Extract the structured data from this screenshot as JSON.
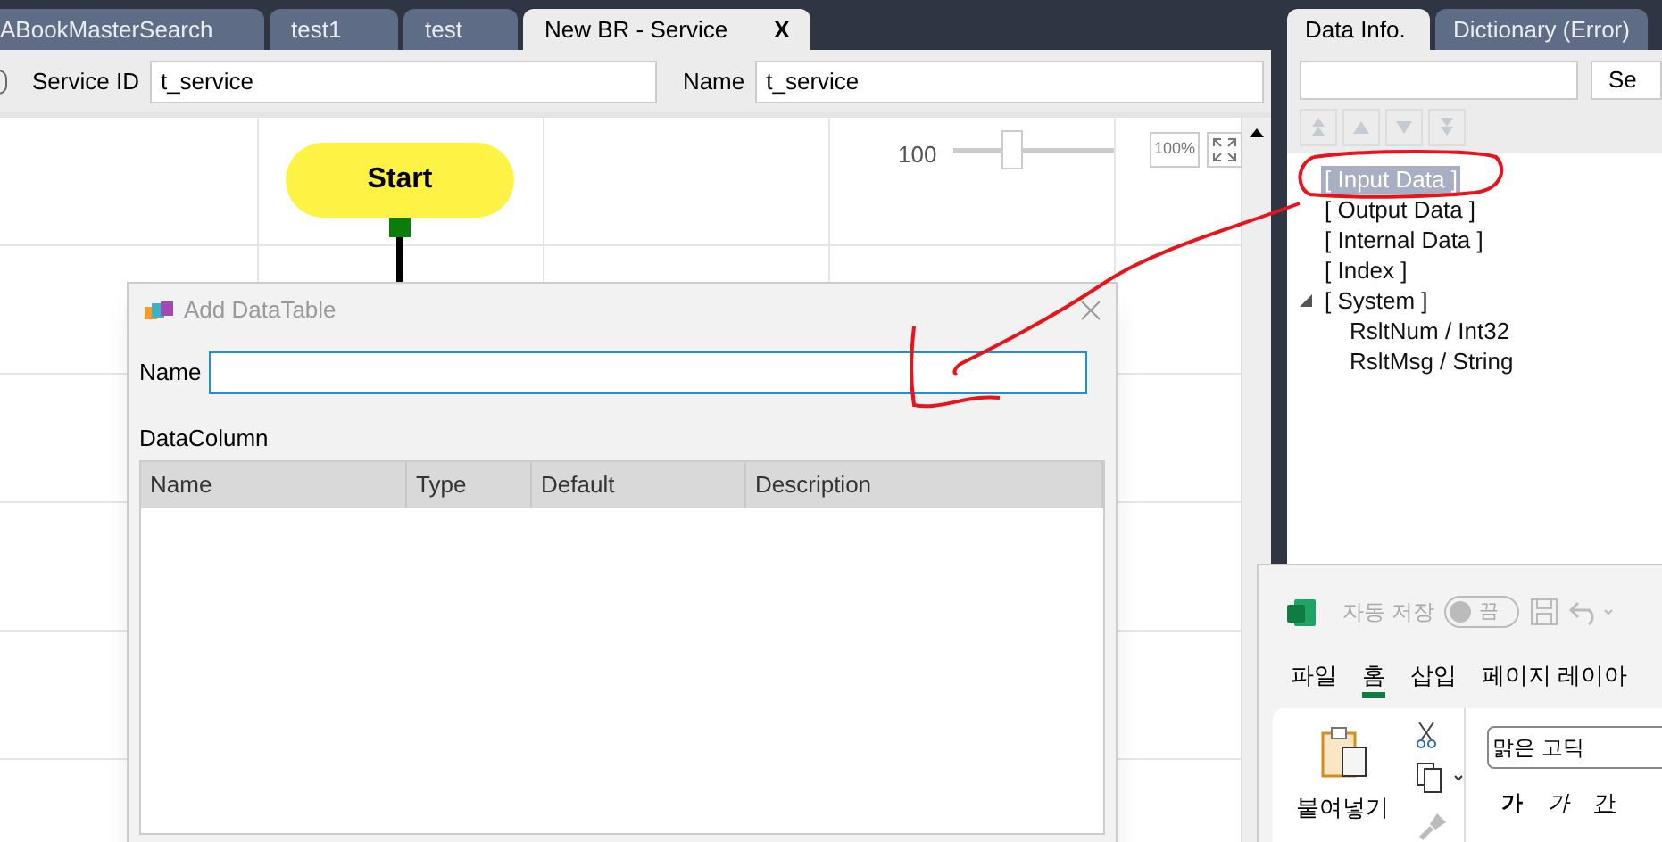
{
  "tabs": [
    {
      "label": "ABookMasterSearch",
      "selected": false
    },
    {
      "label": "test1",
      "selected": false
    },
    {
      "label": "test",
      "selected": false
    },
    {
      "label": "New BR - Service",
      "selected": true,
      "close": "X"
    }
  ],
  "form": {
    "service_id_label": "Service ID",
    "service_id": "t_service",
    "name_label": "Name",
    "name": "t_service"
  },
  "canvas": {
    "zoom_reading": "100",
    "zoom": {
      "level": 0.3
    },
    "fit_label": "100%",
    "start": "Start"
  },
  "dialog": {
    "title": "Add DataTable",
    "name_label": "Name",
    "section": "DataColumn",
    "columns": [
      "Name",
      "Type",
      "Default",
      "Description"
    ]
  },
  "side_tabs": [
    {
      "label": "Data Info.",
      "selected": true
    },
    {
      "label": "Dictionary (Error)",
      "selected": false
    }
  ],
  "side": {
    "search_button": "Se",
    "tree": [
      {
        "label": "[ Input Data ]",
        "selected": true
      },
      {
        "label": "[ Output Data ]",
        "selected": false
      },
      {
        "label": "[ Internal Data ]",
        "selected": false
      },
      {
        "label": "[ Index ]",
        "selected": false
      },
      {
        "label": "[ System ]",
        "selected": false,
        "expanded": true,
        "children": [
          {
            "label": "RsltNum / Int32",
            "selected": false
          },
          {
            "label": "RsltMsg / String",
            "selected": false
          }
        ]
      }
    ]
  },
  "excel": {
    "autosave": "자동 저장",
    "autosave_state": "끔",
    "autosave_on": false,
    "menu": [
      {
        "label": "파일",
        "selected": false
      },
      {
        "label": "홈",
        "selected": true
      },
      {
        "label": "삽입",
        "selected": false
      },
      {
        "label": "페이지 레이아",
        "selected": false
      }
    ],
    "paste": "붙여넣기",
    "font": "맑은 고딕",
    "format": [
      "가",
      "가",
      "간"
    ]
  }
}
